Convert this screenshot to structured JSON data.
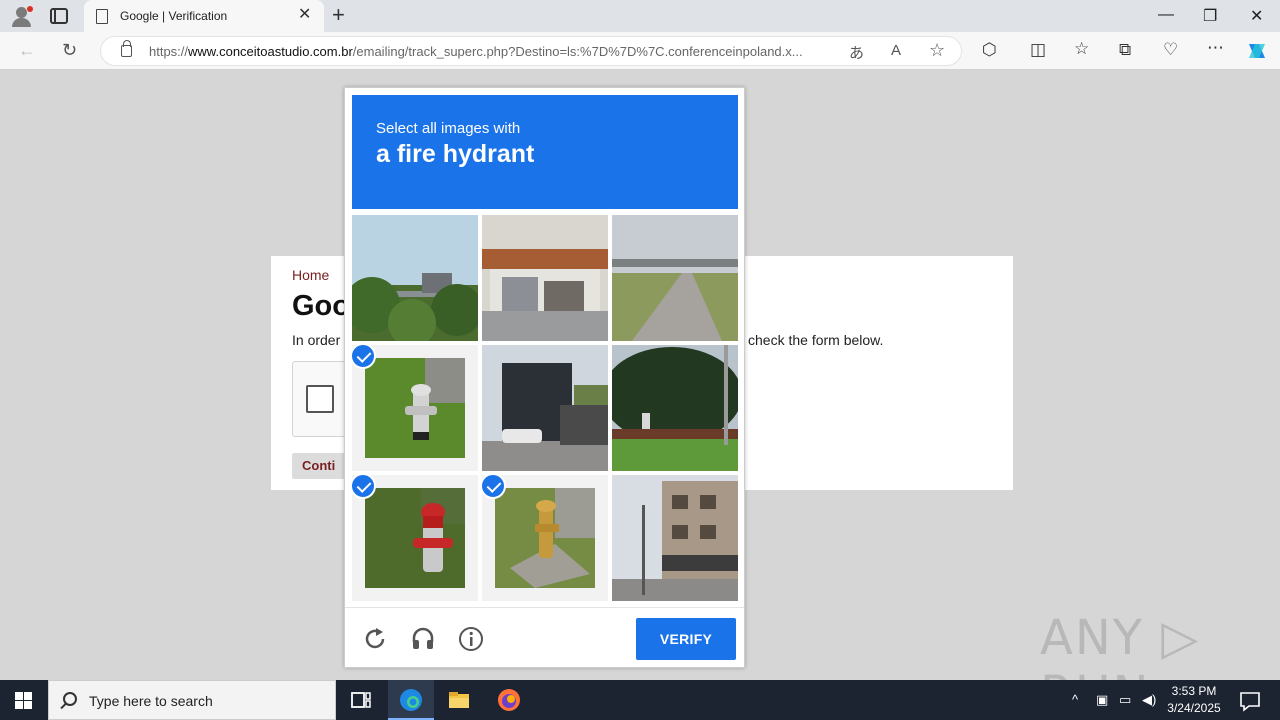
{
  "browser": {
    "tab_title": "Google | Verification",
    "tab_close": "✕",
    "new_tab": "+",
    "url_prefix": "https://",
    "url_host": "www.conceitoastudio.com.br",
    "url_path": "/emailing/track_superc.php?Destino=ls:%7D%7D%7C.conferenceinpoland.x...",
    "win_minimize": "—",
    "win_restore": "❐",
    "win_close": "✕"
  },
  "page": {
    "breadcrumb": "Home",
    "title": "Goo",
    "desc_left": "In order",
    "desc_right": "check the form below.",
    "continue_label": "Conti"
  },
  "challenge": {
    "instruction_line1": "Select all images with",
    "instruction_line2": "a fire hydrant",
    "verify_label": "VERIFY",
    "tiles": [
      {
        "name": "trees-overpass",
        "selected": false
      },
      {
        "name": "building-mural",
        "selected": false
      },
      {
        "name": "road-bridge",
        "selected": false
      },
      {
        "name": "silver-hydrant",
        "selected": true
      },
      {
        "name": "dark-building-street",
        "selected": false
      },
      {
        "name": "hedge-hydrant",
        "selected": false
      },
      {
        "name": "red-hydrant",
        "selected": true
      },
      {
        "name": "yellow-hydrant",
        "selected": true
      },
      {
        "name": "town-street",
        "selected": false
      }
    ]
  },
  "watermark": "ANY ▷ RUN",
  "taskbar": {
    "search_placeholder": "Type here to search",
    "time": "3:53 PM",
    "date": "3/24/2025"
  },
  "colors": {
    "accent": "#1a73e8",
    "breadcrumb": "#7a1f1f"
  }
}
